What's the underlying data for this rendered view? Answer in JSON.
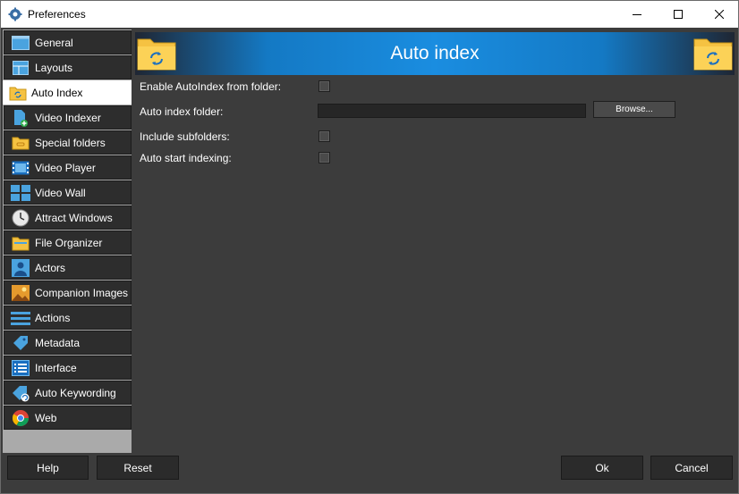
{
  "window": {
    "title": "Preferences",
    "minimize_glyph": "—",
    "maximize_glyph": "☐",
    "close_glyph": "✕"
  },
  "sidebar": {
    "items": [
      {
        "label": "General",
        "icon": "window-icon"
      },
      {
        "label": "Layouts",
        "icon": "layout-icon"
      },
      {
        "label": "Auto Index",
        "icon": "folder-sync-icon",
        "active": true
      },
      {
        "label": "Video Indexer",
        "icon": "document-add-icon"
      },
      {
        "label": "Special folders",
        "icon": "folder-link-icon"
      },
      {
        "label": "Video Player",
        "icon": "film-icon"
      },
      {
        "label": "Video Wall",
        "icon": "video-grid-icon"
      },
      {
        "label": "Attract Windows",
        "icon": "clock-icon"
      },
      {
        "label": "File Organizer",
        "icon": "folder-icon"
      },
      {
        "label": "Actors",
        "icon": "person-icon"
      },
      {
        "label": "Companion Images",
        "icon": "image-icon"
      },
      {
        "label": "Actions",
        "icon": "list-icon"
      },
      {
        "label": "Metadata",
        "icon": "tag-icon"
      },
      {
        "label": "Interface",
        "icon": "interface-icon"
      },
      {
        "label": "Auto Keywording",
        "icon": "tag-refresh-icon"
      },
      {
        "label": "Web",
        "icon": "browser-icon"
      }
    ]
  },
  "main": {
    "title": "Auto index",
    "fields": {
      "enable_label": "Enable AutoIndex from folder:",
      "folder_label": "Auto index folder:",
      "folder_value": "",
      "browse_label": "Browse...",
      "subfolders_label": "Include subfolders:",
      "autostart_label": "Auto start indexing:"
    }
  },
  "footer": {
    "help_label": "Help",
    "reset_label": "Reset",
    "ok_label": "Ok",
    "cancel_label": "Cancel"
  },
  "colors": {
    "background": "#3c3c3c",
    "sidebar_item": "#2d2d2d",
    "banner_blue": "#1a8de0",
    "folder_yellow": "#f5c242"
  }
}
